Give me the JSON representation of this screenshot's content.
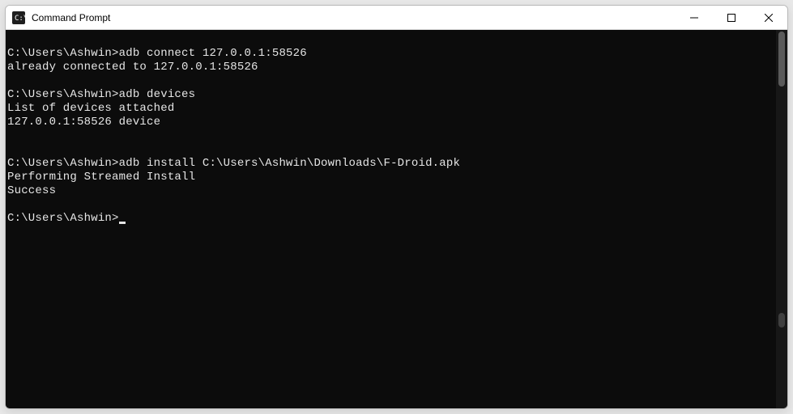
{
  "window": {
    "title": "Command Prompt"
  },
  "terminal": {
    "lines": [
      "",
      "C:\\Users\\Ashwin>adb connect 127.0.0.1:58526",
      "already connected to 127.0.0.1:58526",
      "",
      "C:\\Users\\Ashwin>adb devices",
      "List of devices attached",
      "127.0.0.1:58526 device",
      "",
      "",
      "C:\\Users\\Ashwin>adb install C:\\Users\\Ashwin\\Downloads\\F-Droid.apk",
      "Performing Streamed Install",
      "Success",
      "",
      "C:\\Users\\Ashwin>"
    ],
    "cursor_on_last": true
  }
}
